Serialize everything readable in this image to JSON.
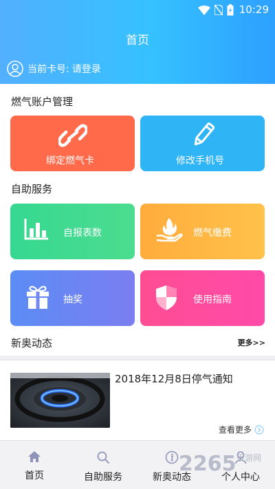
{
  "status": {
    "time": "10:29"
  },
  "header": {
    "title": "首页",
    "card_label": "当前卡号:",
    "card_value": "请登录"
  },
  "account_section": {
    "title": "燃气账户管理",
    "tiles": [
      {
        "label": "绑定燃气卡",
        "icon": "link-icon",
        "color": "#ff6a4a"
      },
      {
        "label": "修改手机号",
        "icon": "pencil-icon",
        "color": "#2fb4f5"
      }
    ]
  },
  "self_service": {
    "title": "自助服务",
    "tiles": [
      {
        "label": "自报表数",
        "icon": "bar-chart-icon",
        "color": "#3ed98b"
      },
      {
        "label": "燃气缴费",
        "icon": "flame-hand-icon",
        "color": "#ffb23f"
      },
      {
        "label": "抽奖",
        "icon": "gift-icon",
        "color": "#6c7df0"
      },
      {
        "label": "使用指南",
        "icon": "shield-icon",
        "color": "#ff4d8f"
      }
    ]
  },
  "news_section": {
    "title": "新奥动态",
    "more_label": "更多>>",
    "items": [
      {
        "title": "2018年12月8日停气通知",
        "more": "查看更多"
      }
    ]
  },
  "tabbar": {
    "tabs": [
      {
        "label": "首页",
        "icon": "home-icon"
      },
      {
        "label": "自助服务",
        "icon": "search-icon"
      },
      {
        "label": "新奥动态",
        "icon": "info-icon"
      },
      {
        "label": "个人中心",
        "icon": "person-icon"
      }
    ]
  },
  "watermark": {
    "text": "2265",
    "sub": "手游网"
  }
}
